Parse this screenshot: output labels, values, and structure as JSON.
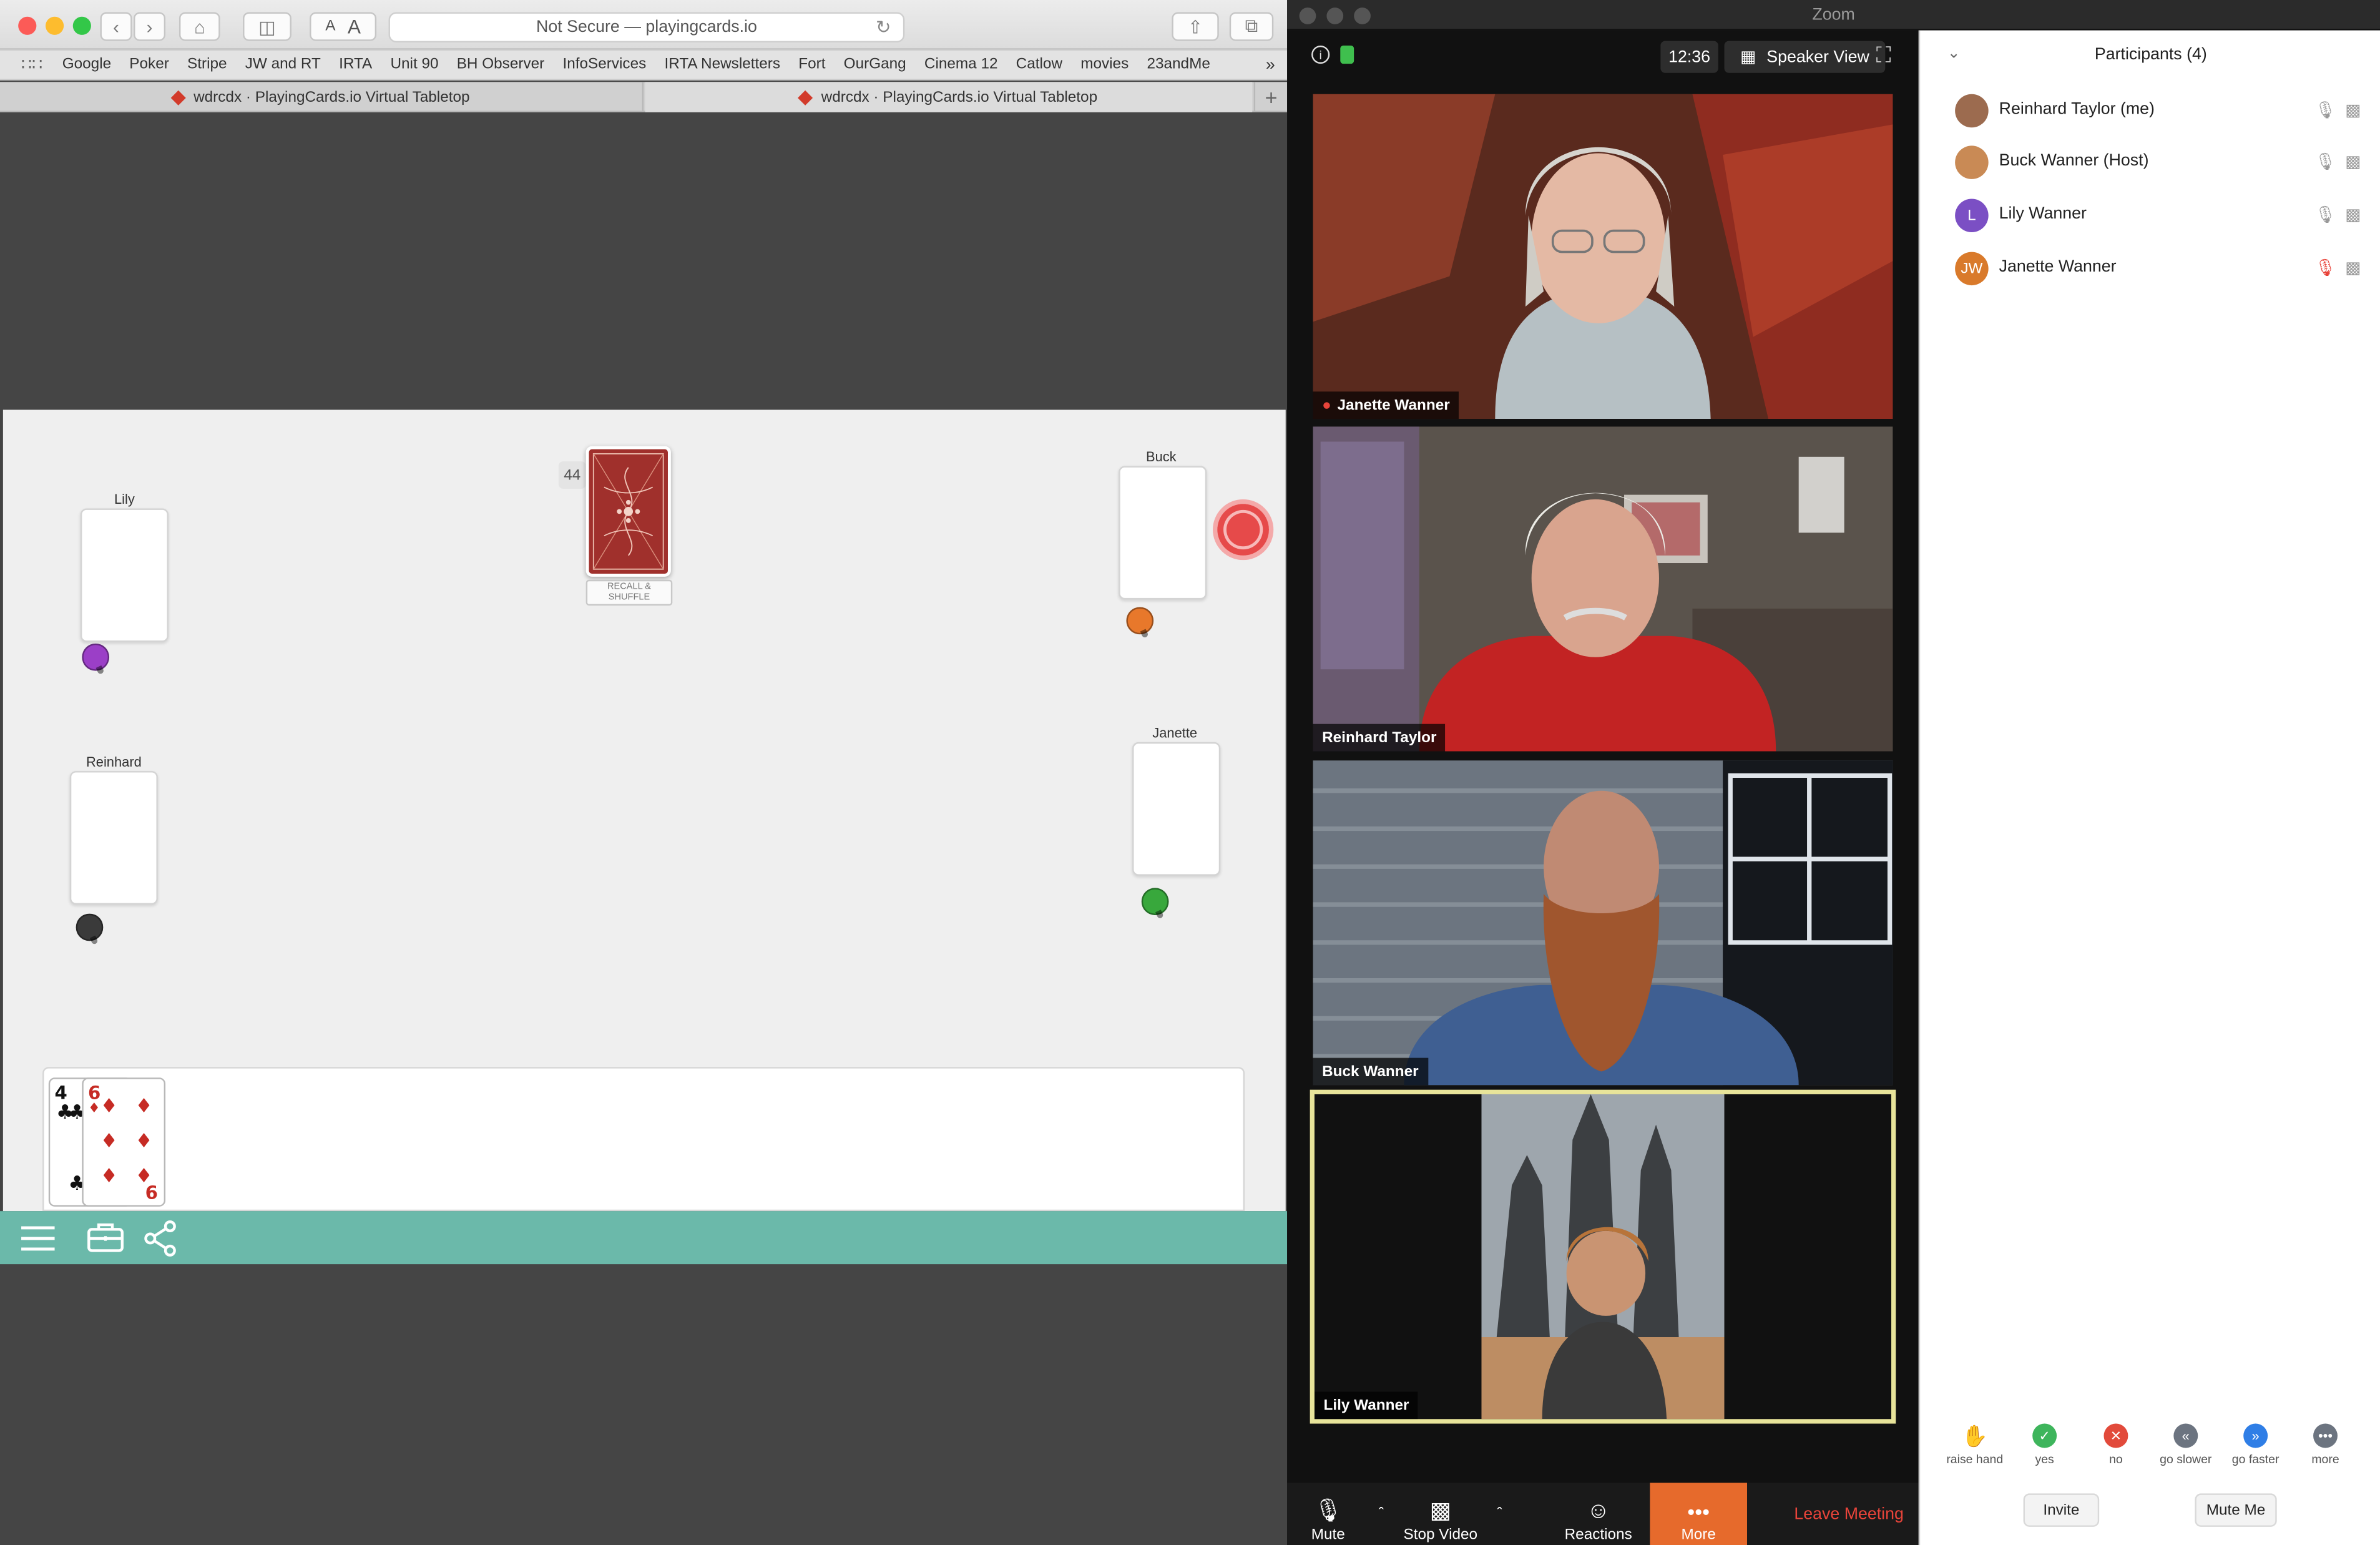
{
  "safari": {
    "address": "Not Secure — playingcards.io",
    "bookmarks": [
      "Google",
      "Poker",
      "Stripe",
      "JW and RT",
      "IRTA",
      "Unit 90",
      "BH Observer",
      "InfoServices",
      "IRTA Newsletters",
      "Fort",
      "OurGang",
      "Cinema 12",
      "Catlow",
      "movies",
      "23andMe"
    ],
    "tabs": [
      "wdrcdx · PlayingCards.io Virtual Tabletop",
      "wdrcdx · PlayingCards.io Virtual Tabletop"
    ]
  },
  "table": {
    "deck_count": "44",
    "recall_label": "RECALL & SHUFFLE",
    "players": {
      "lily": "Lily",
      "buck": "Buck",
      "reinhard": "Reinhard",
      "janette": "Janette"
    },
    "pin_colors": {
      "lily": "#9b3fc7",
      "buck": "#e8782b",
      "reinhard": "#3a3a3a",
      "janette": "#38a83c"
    },
    "hand": [
      {
        "rank": "4",
        "suit": "♣",
        "color": "#111111"
      },
      {
        "rank": "6",
        "suit": "♦",
        "color": "#c62b24"
      }
    ]
  },
  "zoom": {
    "window_title": "Zoom",
    "clock": "12:36",
    "view_label": "Speaker View",
    "videos": [
      "Janette Wanner",
      "Reinhard Taylor",
      "Buck Wanner",
      "Lily Wanner"
    ],
    "controls": {
      "mute": "Mute",
      "stop_video": "Stop Video",
      "reactions": "Reactions",
      "more": "More",
      "leave": "Leave Meeting"
    },
    "participants_title": "Participants (4)",
    "participants": [
      {
        "name": "Reinhard Taylor (me)",
        "initials": "",
        "color": "#9c6b4f"
      },
      {
        "name": "Buck Wanner (Host)",
        "initials": "",
        "color": "#c98a55"
      },
      {
        "name": "Lily Wanner",
        "initials": "L",
        "color": "#7b4fc4"
      },
      {
        "name": "Janette Wanner",
        "initials": "JW",
        "color": "#d97a2b"
      }
    ],
    "reactions": [
      "raise hand",
      "yes",
      "no",
      "go slower",
      "go faster",
      "more"
    ],
    "invite": "Invite",
    "mute_me": "Mute Me",
    "accent": "#e66a2c"
  }
}
